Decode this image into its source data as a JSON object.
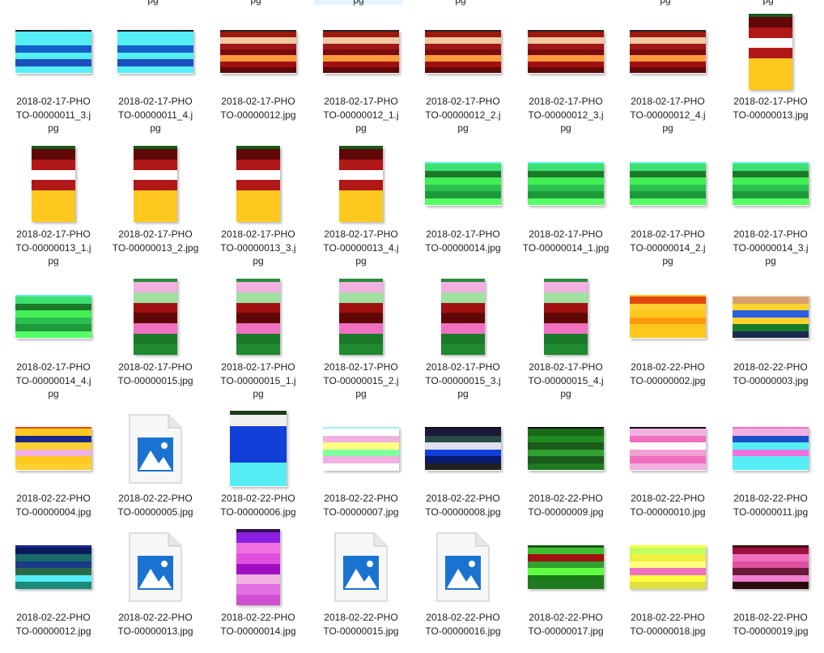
{
  "top_partial_labels": [
    {
      "text": "pg",
      "selected": false
    },
    {
      "text": "pg",
      "selected": false
    },
    {
      "text": "pg",
      "selected": true
    },
    {
      "text": "pg",
      "selected": false
    },
    {
      "text": "pg",
      "selected": false
    },
    {
      "text": "pg",
      "selected": false
    }
  ],
  "files": [
    {
      "line1": "2018-02-17-PHO",
      "line2": "TO-00000011_3.j",
      "line3": "pg",
      "thumb": "wide",
      "colors": [
        "#1a1a1a",
        "#55eef7",
        "#55eef7",
        "#1560c8",
        "#55eef7",
        "#1c4fbf",
        "#55eef7"
      ]
    },
    {
      "line1": "2018-02-17-PHO",
      "line2": "TO-00000011_4.j",
      "line3": "pg",
      "thumb": "wide",
      "colors": [
        "#1a1a1a",
        "#55eef7",
        "#55eef7",
        "#1560c8",
        "#55eef7",
        "#1c4fbf",
        "#55eef7"
      ]
    },
    {
      "line1": "2018-02-17-PHO",
      "line2": "TO-00000012.jpg",
      "line3": "",
      "thumb": "wide",
      "colors": [
        "#222222",
        "#9b1a10",
        "#f0c8a0",
        "#a01818",
        "#7a0c0c",
        "#ff9a3c",
        "#a01010",
        "#600808"
      ]
    },
    {
      "line1": "2018-02-17-PHO",
      "line2": "TO-00000012_1.j",
      "line3": "pg",
      "thumb": "wide",
      "colors": [
        "#222222",
        "#9b1a10",
        "#f0c8a0",
        "#a01818",
        "#7a0c0c",
        "#ff9a3c",
        "#a01010",
        "#600808"
      ]
    },
    {
      "line1": "2018-02-17-PHO",
      "line2": "TO-00000012_2.j",
      "line3": "pg",
      "thumb": "wide",
      "colors": [
        "#222222",
        "#9b1a10",
        "#f0c8a0",
        "#a01818",
        "#7a0c0c",
        "#ff9a3c",
        "#a01010",
        "#600808"
      ]
    },
    {
      "line1": "2018-02-17-PHO",
      "line2": "TO-00000012_3.j",
      "line3": "pg",
      "thumb": "wide",
      "colors": [
        "#222222",
        "#9b1a10",
        "#f0c8a0",
        "#a01818",
        "#7a0c0c",
        "#ff9a3c",
        "#a01010",
        "#600808"
      ]
    },
    {
      "line1": "2018-02-17-PHO",
      "line2": "TO-00000012_4.j",
      "line3": "pg",
      "thumb": "wide",
      "colors": [
        "#222222",
        "#9b1a10",
        "#f0c8a0",
        "#a01818",
        "#7a0c0c",
        "#ff9a3c",
        "#a01010",
        "#600808"
      ]
    },
    {
      "line1": "2018-02-17-PHO",
      "line2": "TO-00000013.jpg",
      "line3": "",
      "thumb": "tall",
      "colors": [
        "#1a5a1a",
        "#600808",
        "#b01818",
        "#ffffff",
        "#b01818",
        "#ffc81e",
        "#ffc81e",
        "#ffc81e"
      ]
    },
    {
      "line1": "2018-02-17-PHO",
      "line2": "TO-00000013_1.j",
      "line3": "pg",
      "thumb": "tall",
      "colors": [
        "#1a5a1a",
        "#600808",
        "#b01818",
        "#ffffff",
        "#b01818",
        "#ffc81e",
        "#ffc81e",
        "#ffc81e"
      ]
    },
    {
      "line1": "2018-02-17-PHO",
      "line2": "TO-00000013_2.jpg",
      "line3": "",
      "thumb": "tall",
      "colors": [
        "#1a5a1a",
        "#600808",
        "#b01818",
        "#ffffff",
        "#b01818",
        "#ffc81e",
        "#ffc81e",
        "#ffc81e"
      ]
    },
    {
      "line1": "2018-02-17-PHO",
      "line2": "TO-00000013_3.j",
      "line3": "pg",
      "thumb": "tall",
      "colors": [
        "#1a5a1a",
        "#600808",
        "#b01818",
        "#ffffff",
        "#b01818",
        "#ffc81e",
        "#ffc81e",
        "#ffc81e"
      ]
    },
    {
      "line1": "2018-02-17-PHO",
      "line2": "TO-00000013_4.j",
      "line3": "pg",
      "thumb": "tall",
      "colors": [
        "#1a5a1a",
        "#600808",
        "#b01818",
        "#ffffff",
        "#b01818",
        "#ffc81e",
        "#ffc81e",
        "#ffc81e"
      ]
    },
    {
      "line1": "2018-02-17-PHO",
      "line2": "TO-00000014.jpg",
      "line3": "",
      "thumb": "wide",
      "colors": [
        "#60f0e0",
        "#3ce070",
        "#1a7a2a",
        "#44ee55",
        "#2ac050",
        "#1c9a3a",
        "#55ff66"
      ]
    },
    {
      "line1": "2018-02-17-PHO",
      "line2": "TO-00000014_1.jpg",
      "line3": "",
      "thumb": "wide",
      "colors": [
        "#60f0e0",
        "#3ce070",
        "#1a7a2a",
        "#44ee55",
        "#2ac050",
        "#1c9a3a",
        "#55ff66"
      ]
    },
    {
      "line1": "2018-02-17-PHO",
      "line2": "TO-00000014_2.j",
      "line3": "pg",
      "thumb": "wide",
      "colors": [
        "#60f0e0",
        "#3ce070",
        "#1a7a2a",
        "#44ee55",
        "#2ac050",
        "#1c9a3a",
        "#55ff66"
      ]
    },
    {
      "line1": "2018-02-17-PHO",
      "line2": "TO-00000014_3.j",
      "line3": "pg",
      "thumb": "wide",
      "colors": [
        "#60f0e0",
        "#3ce070",
        "#1a7a2a",
        "#44ee55",
        "#2ac050",
        "#1c9a3a",
        "#55ff66"
      ]
    },
    {
      "line1": "2018-02-17-PHO",
      "line2": "TO-00000014_4.j",
      "line3": "pg",
      "thumb": "wide",
      "colors": [
        "#60f0e0",
        "#3ce070",
        "#1a7a2a",
        "#44ee55",
        "#2ac050",
        "#1c9a3a",
        "#55ff66"
      ]
    },
    {
      "line1": "2018-02-17-PHO",
      "line2": "TO-00000015.jpg",
      "line3": "",
      "thumb": "tall",
      "colors": [
        "#2a8a3a",
        "#f0b0e0",
        "#a0e0a0",
        "#a01010",
        "#600808",
        "#f070c0",
        "#1a7a2a",
        "#208a30"
      ]
    },
    {
      "line1": "2018-02-17-PHO",
      "line2": "TO-00000015_1.j",
      "line3": "pg",
      "thumb": "tall",
      "colors": [
        "#2a8a3a",
        "#f0b0e0",
        "#a0e0a0",
        "#a01010",
        "#600808",
        "#f070c0",
        "#1a7a2a",
        "#208a30"
      ]
    },
    {
      "line1": "2018-02-17-PHO",
      "line2": "TO-00000015_2.j",
      "line3": "pg",
      "thumb": "tall",
      "colors": [
        "#2a8a3a",
        "#f0b0e0",
        "#a0e0a0",
        "#a01010",
        "#600808",
        "#f070c0",
        "#1a7a2a",
        "#208a30"
      ]
    },
    {
      "line1": "2018-02-17-PHO",
      "line2": "TO-00000015_3.j",
      "line3": "pg",
      "thumb": "tall",
      "colors": [
        "#2a8a3a",
        "#f0b0e0",
        "#a0e0a0",
        "#a01010",
        "#600808",
        "#f070c0",
        "#1a7a2a",
        "#208a30"
      ]
    },
    {
      "line1": "2018-02-17-PHO",
      "line2": "TO-00000015_4.j",
      "line3": "pg",
      "thumb": "tall",
      "colors": [
        "#2a8a3a",
        "#f0b0e0",
        "#a0e0a0",
        "#a01010",
        "#600808",
        "#f070c0",
        "#1a7a2a",
        "#208a30"
      ]
    },
    {
      "line1": "2018-02-22-PHO",
      "line2": "TO-00000002.jpg",
      "line3": "",
      "thumb": "wide",
      "colors": [
        "#ffc81e",
        "#e04a10",
        "#ffd030",
        "#ffc81e",
        "#ff9a10",
        "#ffc81e",
        "#ffc81e"
      ]
    },
    {
      "line1": "2018-02-22-PHO",
      "line2": "TO-00000003.jpg",
      "line3": "",
      "thumb": "wide",
      "colors": [
        "#f4f4e8",
        "#d8a070",
        "#ffd230",
        "#2a5fe0",
        "#ffd030",
        "#1a7a2a",
        "#1a2a50"
      ]
    },
    {
      "line1": "2018-02-22-PHO",
      "line2": "TO-00000004.jpg",
      "line3": "",
      "thumb": "wide",
      "colors": [
        "#e04a10",
        "#ffc81e",
        "#1a2a8a",
        "#ffd030",
        "#f0b0e0",
        "#ffc81e",
        "#ffd030"
      ]
    },
    {
      "line1": "2018-02-22-PHO",
      "line2": "TO-00000005.jpg",
      "line3": "",
      "thumb": "icon",
      "colors": []
    },
    {
      "line1": "2018-02-22-PHO",
      "line2": "TO-00000006.jpg",
      "line3": "",
      "thumb": "tallblue",
      "colors": [
        "#1a3a1a",
        "#f0f0f0",
        "#1040d8",
        "#1040d8",
        "#1040d8",
        "#55eef7",
        "#55eef7"
      ]
    },
    {
      "line1": "2018-02-22-PHO",
      "line2": "TO-00000007.jpg",
      "line3": "",
      "thumb": "wide",
      "colors": [
        "#a0f0f0",
        "#ffffff",
        "#f0b0e0",
        "#ffff80",
        "#80ffa0",
        "#f0b0e0",
        "#ffffff"
      ]
    },
    {
      "line1": "2018-02-22-PHO",
      "line2": "TO-00000008.jpg",
      "line3": "",
      "thumb": "wide",
      "colors": [
        "#101010",
        "#1a1a3a",
        "#2a4a4a",
        "#e0e0f0",
        "#1040d8",
        "#0a1a6a",
        "#202020"
      ]
    },
    {
      "line1": "2018-02-22-PHO",
      "line2": "TO-00000009.jpg",
      "line3": "",
      "thumb": "wide",
      "colors": [
        "#101010",
        "#1a6a1a",
        "#208a20",
        "#1a5a1a",
        "#30a030",
        "#1a5a1a",
        "#207a20"
      ]
    },
    {
      "line1": "2018-02-22-PHO",
      "line2": "TO-00000010.jpg",
      "line3": "",
      "thumb": "wide",
      "colors": [
        "#101010",
        "#f0b0e0",
        "#f070c0",
        "#ffffff",
        "#f0a0d0",
        "#f070c0",
        "#f0b0e0"
      ]
    },
    {
      "line1": "2018-02-22-PHO",
      "line2": "TO-00000011.jpg",
      "line3": "",
      "thumb": "wide",
      "colors": [
        "#f070c0",
        "#f0b0e0",
        "#1a50c8",
        "#55eef7",
        "#f070e0",
        "#55eef7",
        "#55eef7"
      ]
    },
    {
      "line1": "2018-02-22-PHO",
      "line2": "TO-00000012.jpg",
      "line3": "",
      "thumb": "wide",
      "colors": [
        "#1a2a8a",
        "#0a1a5a",
        "#1a6a6a",
        "#1a3a8a",
        "#2a6a4a",
        "#55eef7",
        "#1a8a7a"
      ]
    },
    {
      "line1": "2018-02-22-PHO",
      "line2": "TO-00000013.jpg",
      "line3": "",
      "thumb": "icon",
      "colors": []
    },
    {
      "line1": "2018-02-22-PHO",
      "line2": "TO-00000014.jpg",
      "line3": "",
      "thumb": "tall",
      "colors": [
        "#301050",
        "#8a20e0",
        "#f070e0",
        "#e050e0",
        "#a010c0",
        "#f0b0e0",
        "#e070e0",
        "#d050d0"
      ]
    },
    {
      "line1": "2018-02-22-PHO",
      "line2": "TO-00000015.jpg",
      "line3": "",
      "thumb": "icon",
      "colors": []
    },
    {
      "line1": "2018-02-22-PHO",
      "line2": "TO-00000016.jpg",
      "line3": "",
      "thumb": "icon",
      "colors": []
    },
    {
      "line1": "2018-02-22-PHO",
      "line2": "TO-00000017.jpg",
      "line3": "",
      "thumb": "wide",
      "colors": [
        "#1a5a1a",
        "#40c030",
        "#a01010",
        "#30a030",
        "#60ff40",
        "#1a7a1a",
        "#207a20"
      ]
    },
    {
      "line1": "2018-02-22-PHO",
      "line2": "TO-00000018.jpg",
      "line3": "",
      "thumb": "wide",
      "colors": [
        "#ffff40",
        "#c0ff60",
        "#f0f040",
        "#ffff80",
        "#f070c0",
        "#ffff40",
        "#e0e040"
      ]
    },
    {
      "line1": "2018-02-22-PHO",
      "line2": "TO-00000019.jpg",
      "line3": "",
      "thumb": "wide",
      "colors": [
        "#401010",
        "#a01040",
        "#f070c0",
        "#e050a0",
        "#6a1a3a",
        "#f080d0",
        "#2a0a0a"
      ]
    }
  ]
}
